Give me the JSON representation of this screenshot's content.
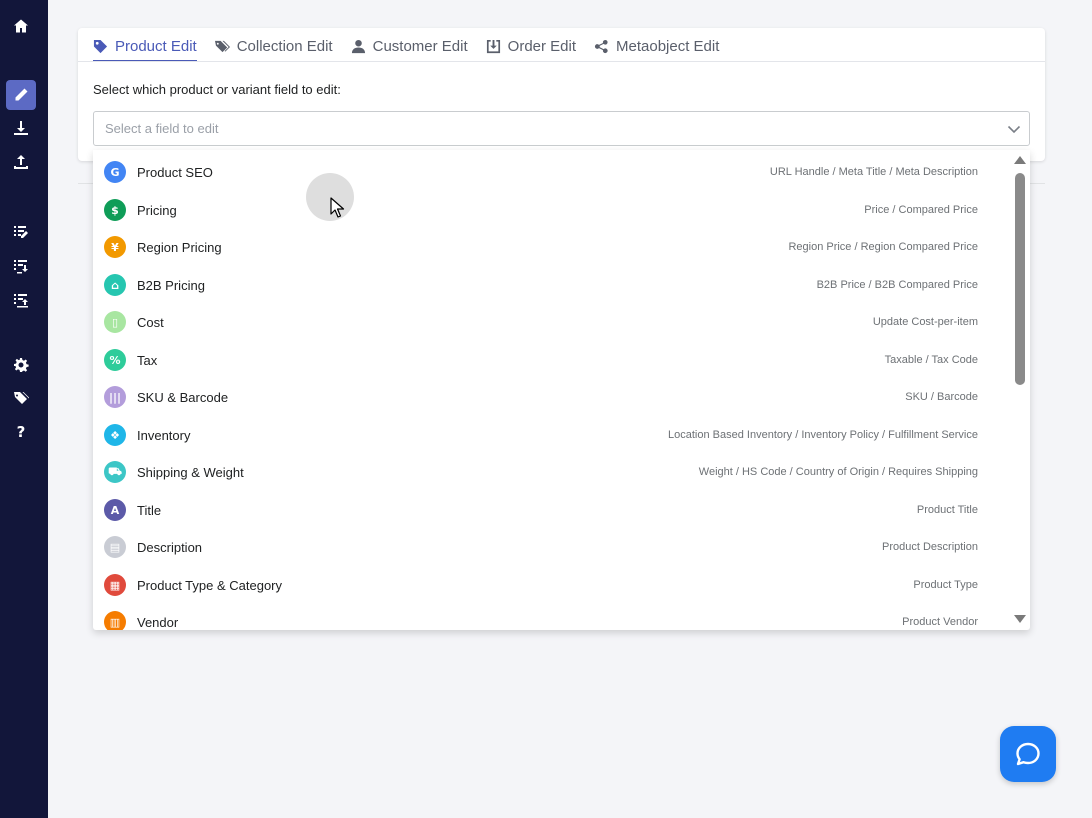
{
  "sidebar": {
    "items": [
      {
        "icon": "home-icon"
      },
      {
        "icon": "pencil-icon",
        "active": true
      },
      {
        "icon": "download-icon"
      },
      {
        "icon": "upload-icon"
      },
      {
        "icon": "list-edit-icon"
      },
      {
        "icon": "list-download-icon"
      },
      {
        "icon": "list-upload-icon"
      },
      {
        "icon": "gear-icon"
      },
      {
        "icon": "tags-icon"
      },
      {
        "icon": "question-icon",
        "label": "?"
      }
    ]
  },
  "tabs": [
    {
      "label": "Product Edit",
      "icon": "tag-icon",
      "active": true
    },
    {
      "label": "Collection Edit",
      "icon": "tags-icon"
    },
    {
      "label": "Customer Edit",
      "icon": "user-icon"
    },
    {
      "label": "Order Edit",
      "icon": "download-box-icon"
    },
    {
      "label": "Metaobject Edit",
      "icon": "share-icon"
    }
  ],
  "field": {
    "label": "Select which product or variant field to edit:",
    "placeholder": "Select a field to edit"
  },
  "options": [
    {
      "name": "Product SEO",
      "desc": "URL Handle / Meta Title / Meta Description",
      "color": "#4285f4",
      "glyph": "G"
    },
    {
      "name": "Pricing",
      "desc": "Price / Compared Price",
      "color": "#0f9d58",
      "glyph": "$"
    },
    {
      "name": "Region Pricing",
      "desc": "Region Price / Region Compared Price",
      "color": "#f29900",
      "glyph": "¥"
    },
    {
      "name": "B2B Pricing",
      "desc": "B2B Price / B2B Compared Price",
      "color": "#26c6b0",
      "glyph": "⌂"
    },
    {
      "name": "Cost",
      "desc": "Update Cost-per-item",
      "color": "#a8e6a1",
      "glyph": "▯"
    },
    {
      "name": "Tax",
      "desc": "Taxable / Tax Code",
      "color": "#2ecc9a",
      "glyph": "%"
    },
    {
      "name": "SKU & Barcode",
      "desc": "SKU / Barcode",
      "color": "#b39ddb",
      "glyph": "|||"
    },
    {
      "name": "Inventory",
      "desc": "Location Based Inventory / Inventory Policy / Fulfillment Service",
      "color": "#1fb6e8",
      "glyph": "❖"
    },
    {
      "name": "Shipping & Weight",
      "desc": "Weight / HS Code / Country of Origin / Requires Shipping",
      "color": "#3cc6c6",
      "glyph": "⛟"
    },
    {
      "name": "Title",
      "desc": "Product Title",
      "color": "#5c5aa8",
      "glyph": "A"
    },
    {
      "name": "Description",
      "desc": "Product Description",
      "color": "#c9ccd4",
      "glyph": "▤"
    },
    {
      "name": "Product Type & Category",
      "desc": "Product Type",
      "color": "#e04a3c",
      "glyph": "▦"
    },
    {
      "name": "Vendor",
      "desc": "Product Vendor",
      "color": "#f57c00",
      "glyph": "▥"
    }
  ],
  "colors": {
    "sidebar": "#12163a",
    "accent": "#4a5ab7",
    "help": "#1f7cf2"
  }
}
